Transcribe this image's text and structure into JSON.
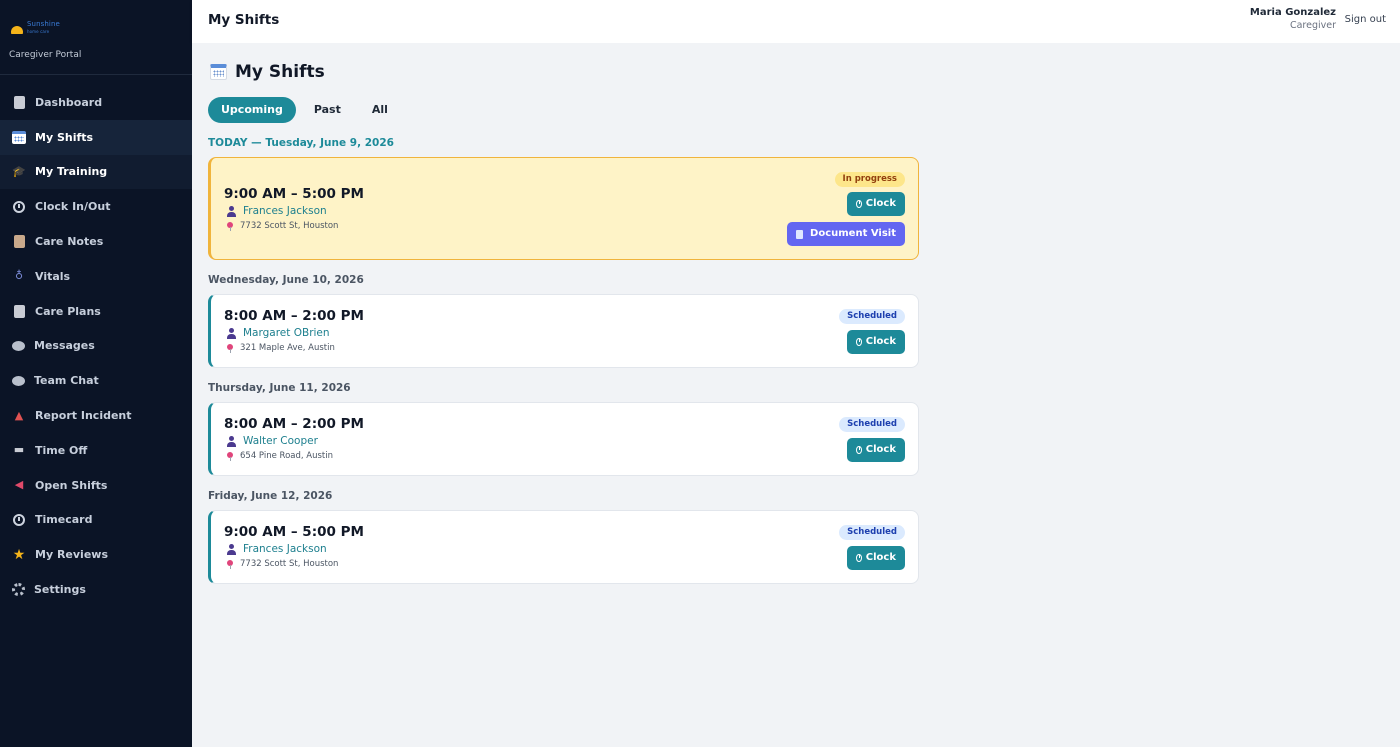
{
  "sidebar": {
    "logo": {
      "name": "Sunshine",
      "tagline": "home care"
    },
    "portal_label": "Caregiver Portal",
    "items": [
      {
        "label": "Dashboard",
        "icon": "clipboard-icon"
      },
      {
        "label": "My Shifts",
        "icon": "calendar-icon"
      },
      {
        "label": "My Training",
        "icon": "graduation-cap-icon"
      },
      {
        "label": "Clock In/Out",
        "icon": "stopwatch-icon"
      },
      {
        "label": "Care Notes",
        "icon": "notepad-icon"
      },
      {
        "label": "Vitals",
        "icon": "stethoscope-icon"
      },
      {
        "label": "Care Plans",
        "icon": "clipboard-icon"
      },
      {
        "label": "Messages",
        "icon": "speech-bubble-icon"
      },
      {
        "label": "Team Chat",
        "icon": "speech-bubble-icon"
      },
      {
        "label": "Report Incident",
        "icon": "siren-icon"
      },
      {
        "label": "Time Off",
        "icon": "beach-icon"
      },
      {
        "label": "Open Shifts",
        "icon": "megaphone-icon"
      },
      {
        "label": "Timecard",
        "icon": "stopwatch-icon"
      },
      {
        "label": "My Reviews",
        "icon": "star-icon"
      },
      {
        "label": "Settings",
        "icon": "gear-icon"
      }
    ]
  },
  "header": {
    "title": "My Shifts",
    "user_name": "Maria Gonzalez",
    "user_role": "Caregiver",
    "sign_out": "Sign out"
  },
  "page": {
    "title": "My Shifts",
    "tabs": [
      "Upcoming",
      "Past",
      "All"
    ]
  },
  "days": [
    {
      "label": "TODAY — Tuesday, June 9, 2026",
      "shift": {
        "time": "9:00 AM – 5:00 PM",
        "client": "Frances Jackson",
        "address": "7732 Scott St, Houston",
        "status": "In progress",
        "clock_label": "Clock",
        "document_label": "Document Visit"
      }
    },
    {
      "label": "Wednesday, June 10, 2026",
      "shift": {
        "time": "8:00 AM – 2:00 PM",
        "client": "Margaret OBrien",
        "address": "321 Maple Ave, Austin",
        "status": "Scheduled",
        "clock_label": "Clock"
      }
    },
    {
      "label": "Thursday, June 11, 2026",
      "shift": {
        "time": "8:00 AM – 2:00 PM",
        "client": "Walter Cooper",
        "address": "654 Pine Road, Austin",
        "status": "Scheduled",
        "clock_label": "Clock"
      }
    },
    {
      "label": "Friday, June 12, 2026",
      "shift": {
        "time": "9:00 AM – 5:00 PM",
        "client": "Frances Jackson",
        "address": "7732 Scott St, Houston",
        "status": "Scheduled",
        "clock_label": "Clock"
      }
    }
  ],
  "colors": {
    "accent": "#1d8a99",
    "sidebar_bg": "#0b1426",
    "in_progress_bg": "#fef3c7",
    "document_button": "#6366f1"
  }
}
